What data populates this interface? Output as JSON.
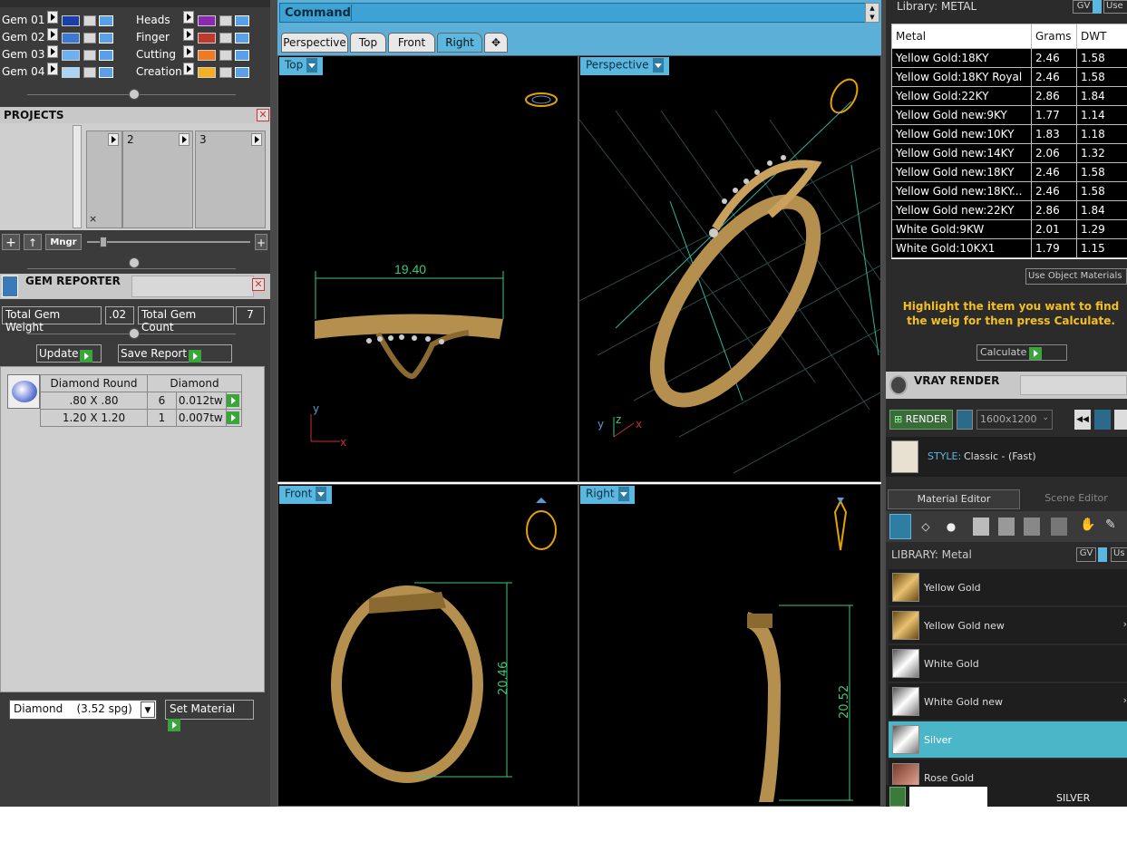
{
  "gem_layers": [
    {
      "label": "Gem 01",
      "color": "#1b3fa8"
    },
    {
      "label": "Gem 02",
      "color": "#3a79d4"
    },
    {
      "label": "Gem 03",
      "color": "#6db0f0"
    },
    {
      "label": "Gem 04",
      "color": "#a8d4f8"
    }
  ],
  "material_layers": [
    {
      "label": "Heads",
      "color": "#8a2ab0"
    },
    {
      "label": "Finger",
      "color": "#c0392b"
    },
    {
      "label": "Cutting",
      "color": "#f07a20"
    },
    {
      "label": "Creation",
      "color": "#f5b020"
    }
  ],
  "projects": {
    "title": "PROJECTS",
    "slots": [
      "",
      "2",
      "3"
    ],
    "mngr_label": "Mngr"
  },
  "gem_reporter": {
    "title": "GEM REPORTER",
    "total_weight_label": "Total Gem Weight",
    "total_weight": ".02",
    "total_count_label": "Total Gem Count",
    "total_count": "7",
    "update_label": "Update",
    "save_report_label": "Save Report",
    "table_headers": [
      "Diamond Round",
      "Diamond"
    ],
    "rows": [
      {
        "size": ".80 X .80",
        "count": "6",
        "weight": "0.012tw"
      },
      {
        "size": "1.20 X 1.20",
        "count": "1",
        "weight": "0.007tw"
      }
    ],
    "material_select": "Diamond    (3.52 spg)",
    "set_material_label": "Set Material"
  },
  "command": {
    "label": "Command:"
  },
  "view_tabs": [
    "Perspective",
    "Top",
    "Front",
    "Right"
  ],
  "active_tab": "Right",
  "viewports": {
    "top": {
      "label": "Top",
      "dimension": "19.40",
      "axis_y": "y",
      "axis_x": "x"
    },
    "perspective": {
      "label": "Perspective",
      "axis_y": "y",
      "axis_z": "z",
      "axis_x": "x"
    },
    "front": {
      "label": "Front",
      "dimension": "20.46"
    },
    "right": {
      "label": "Right",
      "dimension": "20.52"
    }
  },
  "metal_library": {
    "title": "Library: METAL",
    "gv_label": "GV",
    "use_label": "Use",
    "headers": [
      "Metal",
      "Grams",
      "DWT"
    ],
    "rows": [
      [
        "Yellow Gold:18KY",
        "2.46",
        "1.58"
      ],
      [
        "Yellow Gold:18KY Royal",
        "2.46",
        "1.58"
      ],
      [
        "Yellow Gold:22KY",
        "2.86",
        "1.84"
      ],
      [
        "Yellow Gold new:9KY",
        "1.77",
        "1.14"
      ],
      [
        "Yellow Gold new:10KY",
        "1.83",
        "1.18"
      ],
      [
        "Yellow Gold new:14KY",
        "2.06",
        "1.32"
      ],
      [
        "Yellow Gold new:18KY",
        "2.46",
        "1.58"
      ],
      [
        "Yellow Gold new:18KY...",
        "2.46",
        "1.58"
      ],
      [
        "Yellow Gold new:22KY",
        "2.86",
        "1.84"
      ],
      [
        "White Gold:9KW",
        "2.01",
        "1.29"
      ],
      [
        "White Gold:10KX1",
        "1.79",
        "1.15"
      ]
    ],
    "use_object_materials": "Use Object Materials",
    "hint": "Highlight the item you want to find the weig for then press Calculate.",
    "calculate_label": "Calculate"
  },
  "vray": {
    "title": "VRAY RENDER",
    "render_label": "RENDER",
    "resolution": "1600x1200",
    "style_label": "STYLE:",
    "style_value": "Classic - (Fast)"
  },
  "material_editor": {
    "tab_material": "Material Editor",
    "tab_scene": "Scene Editor",
    "library_label": "LIBRARY: Metal",
    "gv_label": "GV",
    "use_label": "Us",
    "items": [
      "Yellow Gold",
      "Yellow Gold new",
      "White Gold",
      "White Gold new",
      "Silver",
      "Rose Gold"
    ],
    "selected": "Silver",
    "preview_label": "SILVER"
  }
}
